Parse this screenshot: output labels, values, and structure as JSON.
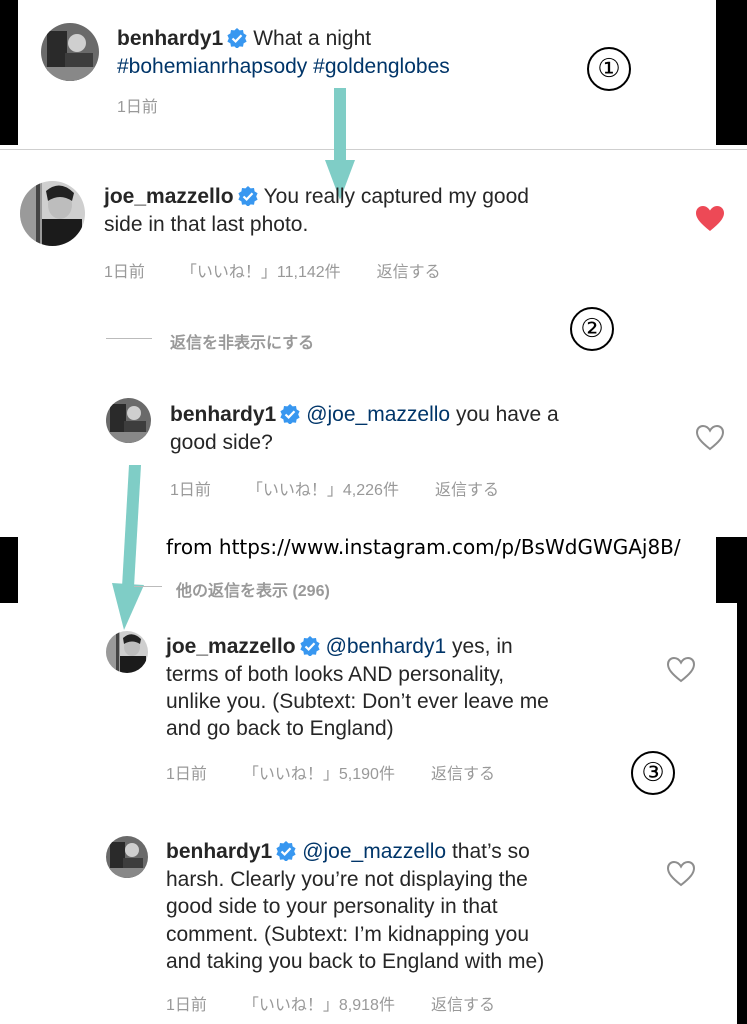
{
  "panel1": {
    "username": "benhardy1",
    "text": "What a night",
    "hashtags": "#bohemianrhapsody #goldenglobes",
    "time": "1日前",
    "marker": "①"
  },
  "panel2": {
    "comment": {
      "username": "joe_mazzello",
      "line1": "You really captured my good",
      "line2": "side in that last photo.",
      "time": "1日前",
      "likes": "「いいね！」11,142件",
      "reply": "返信する",
      "liked": true
    },
    "hide_replies": "返信を非表示にする",
    "marker": "②",
    "reply": {
      "username": "benhardy1",
      "mention": "@joe_mazzello",
      "line1": "you have a",
      "line2": "good side?",
      "time": "1日前",
      "likes": "「いいね！」4,226件",
      "reply": "返信する"
    }
  },
  "source_note": "from https://www.instagram.com/p/BsWdGWGAj8B/",
  "view_more": "他の返信を表示 (296)",
  "panel3": {
    "marker": "③",
    "reply1": {
      "username": "joe_mazzello",
      "mention": "@benhardy1",
      "line1": "yes, in",
      "line2": "terms of both looks AND personality,",
      "line3": "unlike you. (Subtext: Don’t ever leave me",
      "line4": "and go back to England)",
      "time": "1日前",
      "likes": "「いいね！」5,190件",
      "reply": "返信する"
    },
    "reply2": {
      "username": "benhardy1",
      "mention": "@joe_mazzello",
      "line1": "that’s so",
      "line2": "harsh. Clearly you’re not displaying the",
      "line3": "good side to your personality in that",
      "line4": "comment. (Subtext: I’m kidnapping you",
      "line5": "and taking you back to England with me)",
      "time": "1日前",
      "likes": "「いいね！」8,918件",
      "reply": "返信する"
    }
  },
  "colors": {
    "link": "#003569",
    "verified": "#3897f0",
    "heart_liked": "#ed4956",
    "arrow": "#7fcdc6",
    "meta": "#999999"
  }
}
